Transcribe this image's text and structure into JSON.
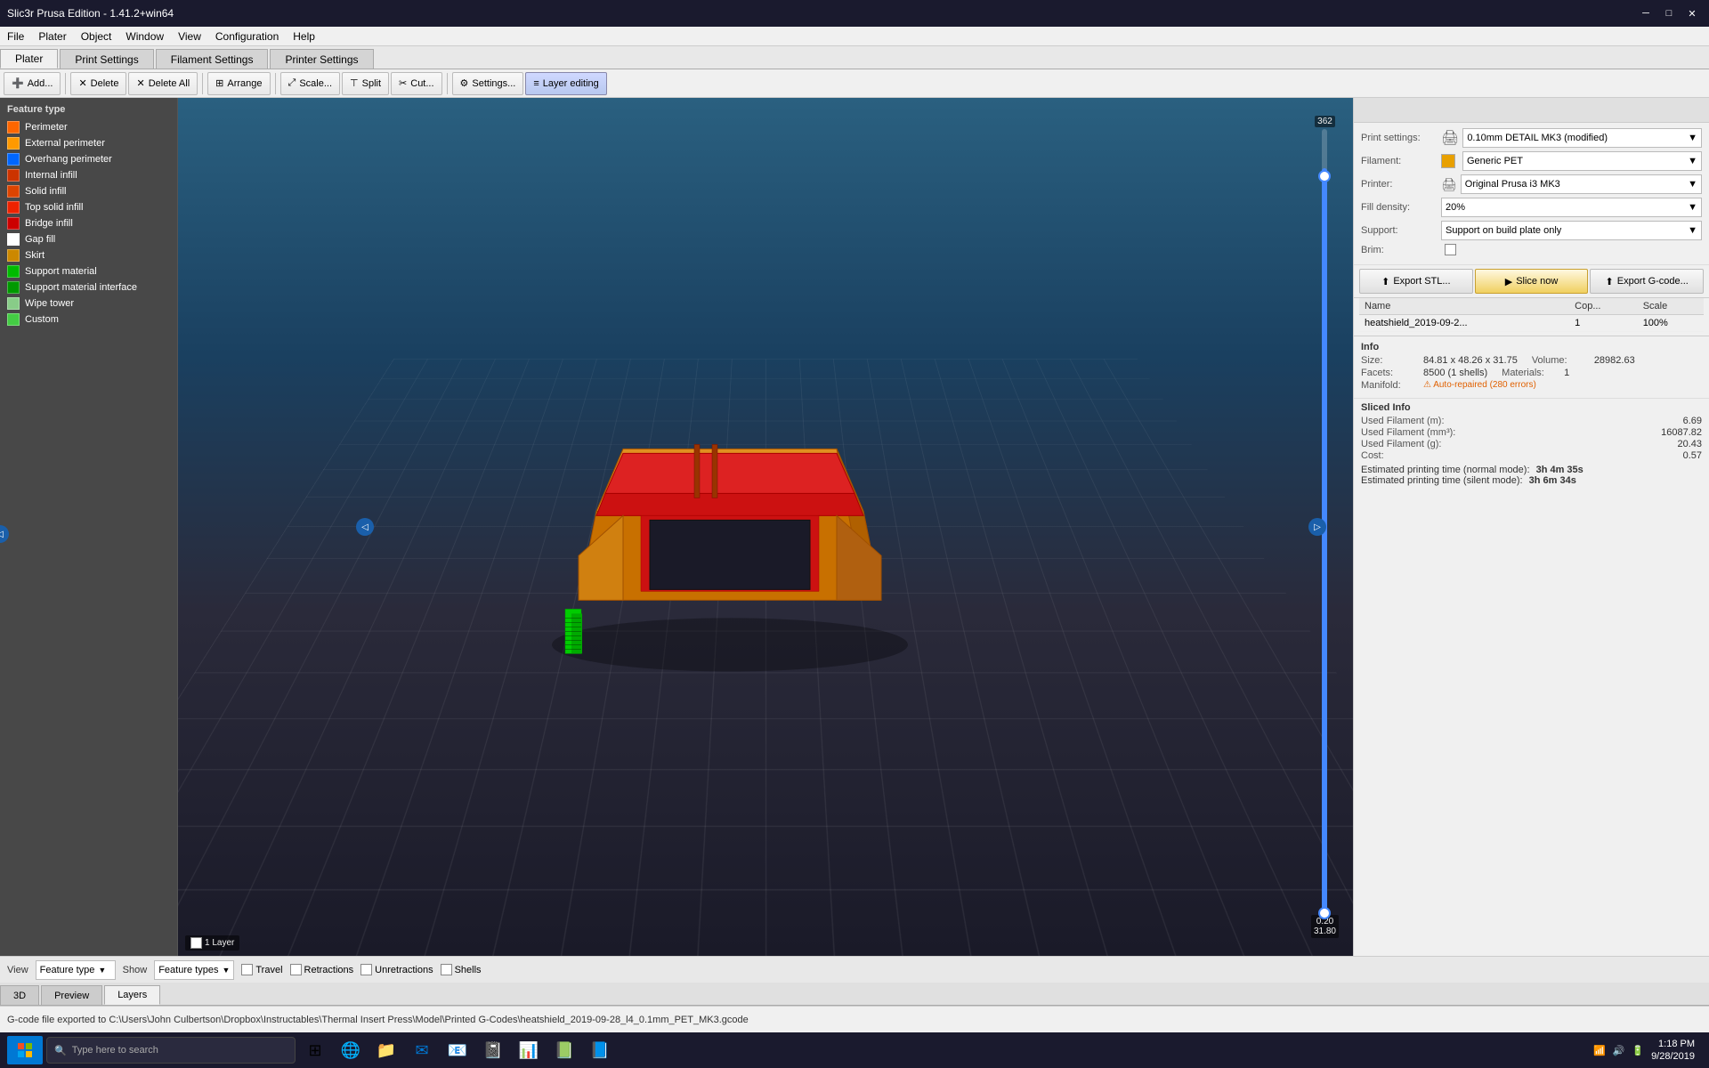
{
  "app": {
    "title": "Slic3r Prusa Edition - 1.41.2+win64",
    "window_controls": [
      "minimize",
      "maximize",
      "close"
    ]
  },
  "menu": {
    "items": [
      "File",
      "Plater",
      "Object",
      "Window",
      "View",
      "Configuration",
      "Help"
    ]
  },
  "tabs": {
    "items": [
      "Plater",
      "Print Settings",
      "Filament Settings",
      "Printer Settings"
    ]
  },
  "toolbar": {
    "add_label": "Add...",
    "delete_label": "Delete",
    "delete_all_label": "Delete All",
    "arrange_label": "Arrange",
    "scale_label": "Scale...",
    "split_label": "Split",
    "cut_label": "Cut...",
    "settings_label": "Settings...",
    "layer_editing_label": "Layer editing"
  },
  "feature_types": {
    "header": "Feature type",
    "items": [
      {
        "label": "Perimeter",
        "color": "#ff6600"
      },
      {
        "label": "External perimeter",
        "color": "#ff8800"
      },
      {
        "label": "Overhang perimeter",
        "color": "#0066ff"
      },
      {
        "label": "Internal infill",
        "color": "#cc3300"
      },
      {
        "label": "Solid infill",
        "color": "#dd4400"
      },
      {
        "label": "Top solid infill",
        "color": "#ee2200"
      },
      {
        "label": "Bridge infill",
        "color": "#cc0000"
      },
      {
        "label": "Gap fill",
        "color": "#ffffff"
      },
      {
        "label": "Skirt",
        "color": "#cc8800"
      },
      {
        "label": "Support material",
        "color": "#00bb00"
      },
      {
        "label": "Support material interface",
        "color": "#009900"
      },
      {
        "label": "Wipe tower",
        "color": "#88cc88"
      },
      {
        "label": "Custom",
        "color": "#44cc44"
      }
    ]
  },
  "print_settings": {
    "label": "Print settings:",
    "profile": "0.10mm DETAIL MK3 (modified)",
    "filament_label": "Filament:",
    "filament_color": "#e8a000",
    "filament_name": "Generic PET",
    "printer_label": "Printer:",
    "printer_name": "Original Prusa i3 MK3",
    "fill_density_label": "Fill density:",
    "fill_density_value": "20%",
    "support_label": "Support:",
    "support_value": "Support on build plate only",
    "brim_label": "Brim:"
  },
  "action_buttons": {
    "export_stl": "Export STL...",
    "slice_now": "Slice now",
    "export_gcode": "Export G-code..."
  },
  "files_table": {
    "columns": [
      "Name",
      "Cop...",
      "Scale"
    ],
    "rows": [
      {
        "name": "heatshield_2019-09-2...",
        "copies": "1",
        "scale": "100%"
      }
    ]
  },
  "info": {
    "header": "Info",
    "size_label": "Size:",
    "size_value": "84.81 x 48.26 x 31.75",
    "facets_label": "Facets:",
    "facets_value": "8500 (1 shells)",
    "manifold_label": "Manifold:",
    "manifold_value": "Auto-repaired (280 errors)",
    "volume_label": "Volume:",
    "volume_value": "28982.63",
    "materials_label": "Materials:",
    "materials_value": "1"
  },
  "sliced_info": {
    "header": "Sliced Info",
    "used_filament_m_label": "Used Filament (m):",
    "used_filament_m_value": "6.69",
    "used_filament_mm3_label": "Used Filament (mm³):",
    "used_filament_mm3_value": "16087.82",
    "used_filament_g_label": "Used Filament (g):",
    "used_filament_g_value": "20.43",
    "cost_label": "Cost:",
    "cost_value": "0.57",
    "print_time_normal_label": "Estimated printing time (normal mode):",
    "print_time_normal_value": "3h 4m 35s",
    "print_time_silent_label": "Estimated printing time (silent mode):",
    "print_time_silent_value": "3h 6m 34s"
  },
  "viewport_controls": {
    "view_label": "View",
    "view_type": "Feature type",
    "show_label": "Show",
    "show_type": "Feature types",
    "travel_label": "Travel",
    "retractions_label": "Retractions",
    "unretractions_label": "Unretractions",
    "shells_label": "Shells",
    "layer_label": "1 Layer"
  },
  "view_tabs": {
    "items": [
      "3D",
      "Preview",
      "Layers"
    ]
  },
  "layer_range": {
    "top": "362",
    "bottom_min": "0.20",
    "bottom_max": "31.80"
  },
  "status_bar": {
    "text": "G-code file exported to C:\\Users\\John Culbertson\\Dropbox\\Instructables\\Thermal Insert Press\\Model\\Printed G-Codes\\heatshield_2019-09-28_l4_0.1mm_PET_MK3.gcode"
  },
  "taskbar": {
    "search_placeholder": "Type here to search",
    "time": "1:18 PM",
    "date": "9/28/2019"
  }
}
